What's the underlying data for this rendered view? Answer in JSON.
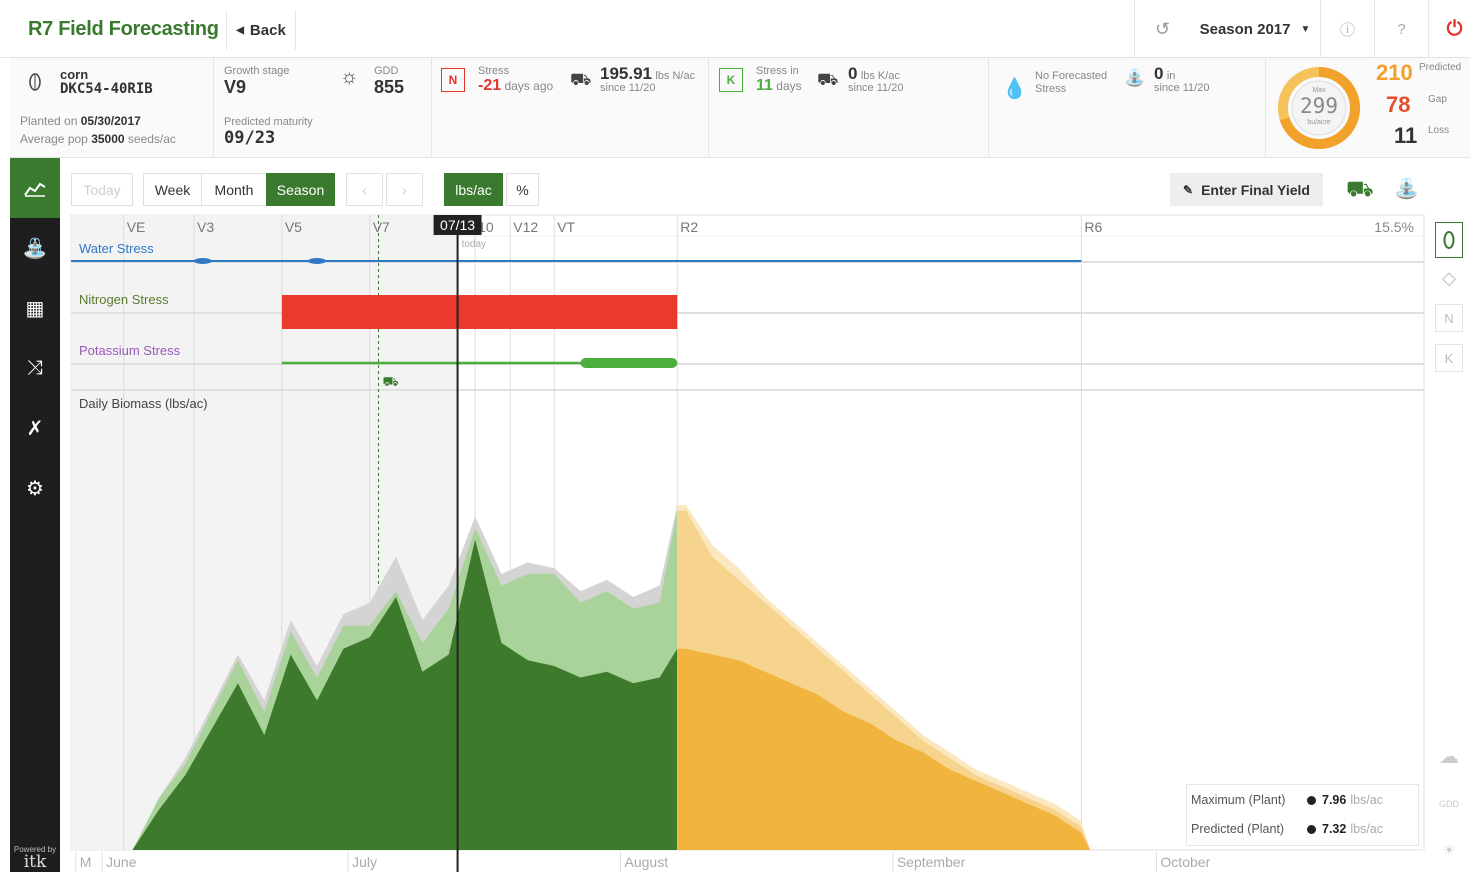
{
  "app": {
    "title": "R7 Field Forecasting",
    "back_label": "Back"
  },
  "topbar": {
    "season_label": "Season 2017",
    "history_icon": "history-icon",
    "info_icon": "info-icon",
    "help_icon": "help-icon",
    "power_icon": "power-icon"
  },
  "field": {
    "crop": "corn",
    "hybrid": "DKC54-40RIB",
    "planted_prefix": "Planted on",
    "planted_date": "05/30/2017",
    "pop_prefix": "Average pop",
    "pop_value": "35000",
    "pop_unit": "seeds/ac",
    "growth_stage_label": "Growth stage",
    "growth_stage": "V9",
    "maturity_label": "Predicted maturity",
    "maturity": "09/23",
    "gdd_label": "GDD",
    "gdd": "855"
  },
  "nitrogen": {
    "badge": "N",
    "stress_label": "Stress",
    "days": "-21",
    "days_suffix": "days ago",
    "amount": "195.91",
    "unit": "lbs N/ac",
    "since": "since 11/20"
  },
  "potassium": {
    "badge": "K",
    "stress_label": "Stress in",
    "days": "11",
    "days_suffix": "days",
    "amount": "0",
    "unit": "lbs K/ac",
    "since": "since 11/20"
  },
  "water": {
    "stress_label_1": "No Forecasted",
    "stress_label_2": "Stress",
    "amount": "0",
    "unit": "in",
    "since": "since 11/20"
  },
  "yield": {
    "max_label": "Max",
    "max": "299",
    "unit": "bu/acre",
    "predicted": "210",
    "predicted_label": "Predicted",
    "gap": "78",
    "gap_label": "Gap",
    "loss": "11",
    "loss_label": "Loss",
    "ring_fraction": 0.7,
    "colors": {
      "predicted": "#f2a12a",
      "gap": "#e64d2a",
      "loss": "#555555",
      "track": "#f5c35a"
    }
  },
  "controls": {
    "today": "Today",
    "week": "Week",
    "month": "Month",
    "season": "Season",
    "prev": "‹",
    "next": "›",
    "unit_lbs": "lbs/ac",
    "unit_pct": "%",
    "enter_final_yield": "Enter Final Yield"
  },
  "sidebar": {
    "items": [
      "chart-icon",
      "irrigation-icon",
      "field-map-icon",
      "scenario-icon",
      "tools-icon",
      "settings-icon"
    ],
    "powered_by": "Powered by",
    "brand": "itk"
  },
  "chart_data": {
    "type": "area",
    "stages": [
      {
        "label": "VE",
        "date": "06-05"
      },
      {
        "label": "V3",
        "date": "06-13"
      },
      {
        "label": "V5",
        "date": "06-23"
      },
      {
        "label": "V7",
        "date": "07-03"
      },
      {
        "label": "10",
        "date": "07-15"
      },
      {
        "label": "V12",
        "date": "07-19"
      },
      {
        "label": "VT",
        "date": "07-24"
      },
      {
        "label": "R2",
        "date": "08-07"
      },
      {
        "label": "R6",
        "date": "09-22"
      }
    ],
    "today_date": "07-13",
    "today_badge": "07/13",
    "today_label": "today",
    "percent_label": "15.5%",
    "x_start": "05-30",
    "x_end": "10-31",
    "months": [
      {
        "label": "M",
        "date": "05-31"
      },
      {
        "label": "June",
        "date": "06-03"
      },
      {
        "label": "July",
        "date": "07-01"
      },
      {
        "label": "August",
        "date": "08-01"
      },
      {
        "label": "September",
        "date": "09-01"
      },
      {
        "label": "October",
        "date": "10-01"
      }
    ],
    "water_stress": {
      "label": "Water Stress",
      "start": "05-30",
      "end": "09-22",
      "markers": [
        "06-14",
        "06-27"
      ],
      "color": "#2f78c4"
    },
    "nitrogen_stress": {
      "label": "Nitrogen Stress",
      "start": "06-23",
      "end": "08-07",
      "color": "#ea3a30"
    },
    "potassium_stress": {
      "label": "Potassium Stress",
      "start": "06-23",
      "end": "08-07",
      "thick_start": "07-27",
      "color": "#4cae3d"
    },
    "fertilizer_event": {
      "date": "07-04",
      "icon": "tractor-icon"
    },
    "biomass_label": "Daily Biomass (lbs/ac)",
    "ylim": [
      0,
      8
    ],
    "dates": [
      "06-06",
      "06-09",
      "06-12",
      "06-15",
      "06-18",
      "06-21",
      "06-24",
      "06-27",
      "06-30",
      "07-03",
      "07-06",
      "07-09",
      "07-12",
      "07-15",
      "07-18",
      "07-21",
      "07-24",
      "07-27",
      "07-30",
      "08-02",
      "08-05",
      "08-07",
      "08-08",
      "08-11",
      "08-14",
      "08-17",
      "08-20",
      "08-23",
      "08-26",
      "08-29",
      "09-01",
      "09-04",
      "09-07",
      "09-10",
      "09-13",
      "09-16",
      "09-19",
      "09-22",
      "09-23"
    ],
    "series": [
      {
        "name": "Maximum",
        "color": "#d4d4d4",
        "values": [
          0.0,
          0.9,
          1.6,
          2.5,
          3.4,
          2.6,
          4.0,
          3.2,
          4.1,
          4.3,
          5.1,
          4.0,
          4.6,
          5.8,
          4.8,
          5.0,
          4.9,
          4.5,
          4.7,
          4.4,
          4.6,
          6.0,
          6.0,
          5.3,
          4.9,
          4.4,
          4.0,
          3.6,
          3.2,
          2.8,
          2.4,
          2.0,
          1.7,
          1.4,
          1.2,
          1.0,
          0.8,
          0.5,
          0.0
        ]
      },
      {
        "name": "Potential",
        "color": "#a9d39a",
        "values": [
          0.0,
          0.9,
          1.5,
          2.4,
          3.3,
          2.4,
          3.8,
          3.0,
          3.9,
          3.9,
          4.5,
          3.6,
          4.2,
          5.6,
          4.6,
          4.8,
          4.8,
          4.3,
          4.5,
          4.2,
          4.3,
          5.9,
          5.9,
          5.1,
          4.7,
          4.3,
          3.9,
          3.5,
          3.1,
          2.7,
          2.3,
          1.9,
          1.6,
          1.3,
          1.1,
          0.9,
          0.7,
          0.4,
          0.0
        ]
      },
      {
        "name": "Predicted",
        "color": "#3e7a2c",
        "values": [
          0.0,
          0.7,
          1.3,
          2.1,
          2.9,
          2.0,
          3.4,
          2.6,
          3.5,
          3.7,
          4.4,
          3.1,
          3.4,
          5.4,
          3.6,
          3.3,
          3.2,
          3.0,
          3.1,
          2.9,
          3.0,
          3.5,
          3.5,
          3.4,
          3.3,
          3.1,
          2.9,
          2.7,
          2.4,
          2.2,
          1.9,
          1.7,
          1.4,
          1.2,
          1.0,
          0.8,
          0.6,
          0.3,
          0.0
        ]
      }
    ],
    "legend": [
      {
        "label": "Maximum (Plant)",
        "value": "7.96",
        "unit": "lbs/ac"
      },
      {
        "label": "Predicted (Plant)",
        "value": "7.32",
        "unit": "lbs/ac"
      }
    ],
    "forecast_colors": {
      "max": "#fbe7c0",
      "potential": "#f6d48d",
      "predicted": "#f1b53f"
    }
  },
  "rightcol": {
    "items": [
      "corn-icon",
      "water-drop-icon",
      "N",
      "K"
    ],
    "gdd": "GDD"
  }
}
